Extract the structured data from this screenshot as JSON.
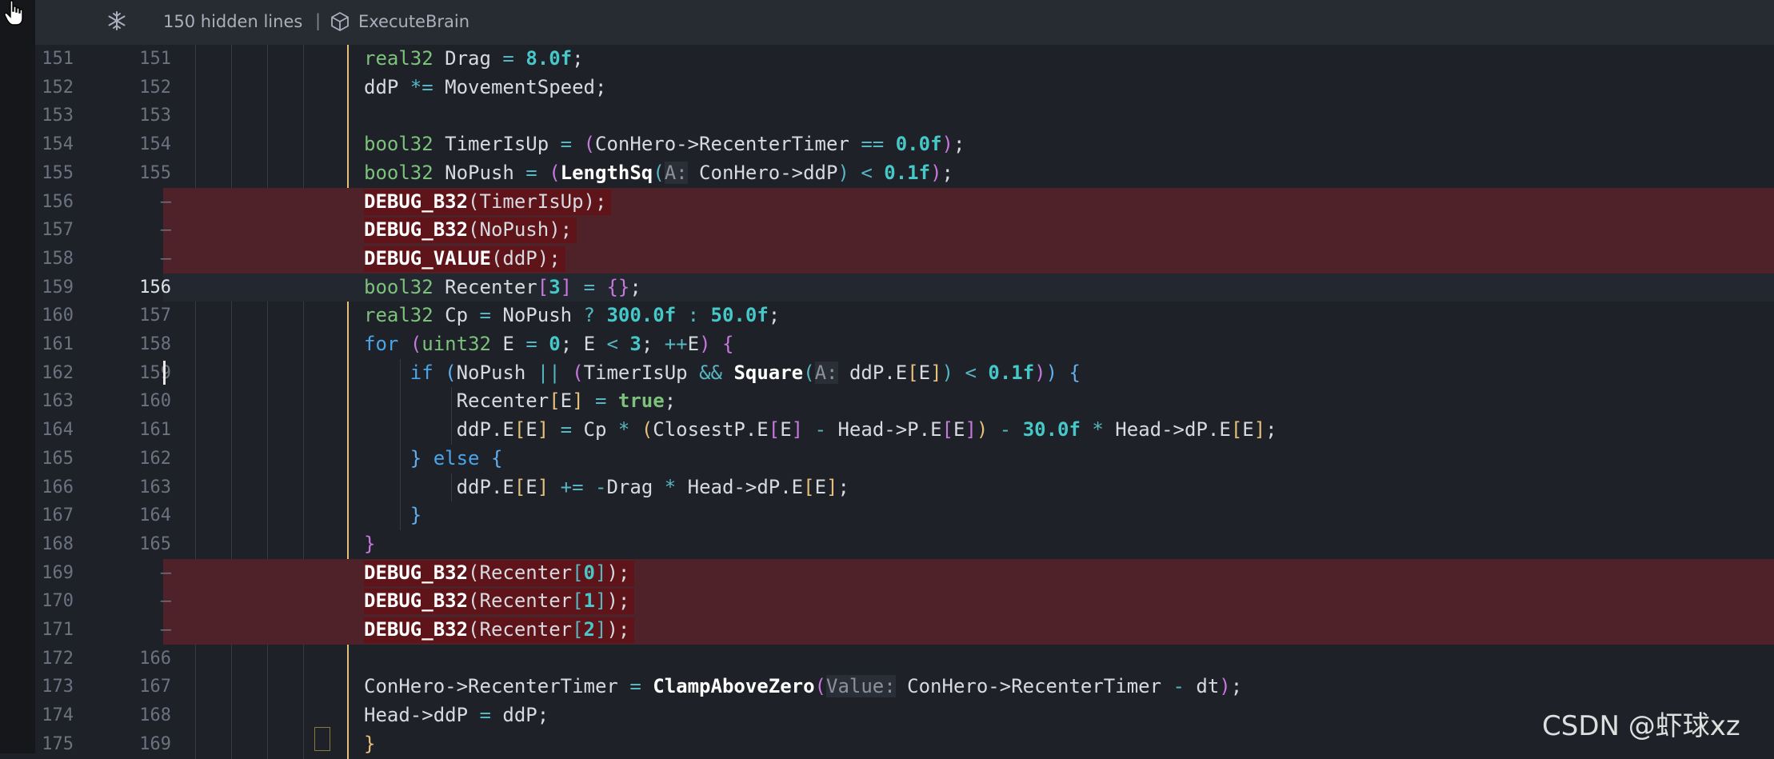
{
  "header": {
    "hidden_lines_label": "150 hidden lines",
    "separator": "|",
    "symbol_name": "ExecuteBrain",
    "fold_icon": "snowflake-fold-icon",
    "symbol_icon": "cube-icon"
  },
  "lines": [
    {
      "old": "151",
      "new": "151",
      "kind": "normal"
    },
    {
      "old": "152",
      "new": "152",
      "kind": "normal"
    },
    {
      "old": "153",
      "new": "153",
      "kind": "normal"
    },
    {
      "old": "154",
      "new": "154",
      "kind": "normal"
    },
    {
      "old": "155",
      "new": "155",
      "kind": "normal"
    },
    {
      "old": "156",
      "new": "—",
      "kind": "deleted"
    },
    {
      "old": "157",
      "new": "—",
      "kind": "deleted"
    },
    {
      "old": "158",
      "new": "—",
      "kind": "deleted"
    },
    {
      "old": "159",
      "new": "156",
      "kind": "current"
    },
    {
      "old": "160",
      "new": "157",
      "kind": "normal"
    },
    {
      "old": "161",
      "new": "158",
      "kind": "normal"
    },
    {
      "old": "162",
      "new": "159",
      "kind": "normal"
    },
    {
      "old": "163",
      "new": "160",
      "kind": "normal"
    },
    {
      "old": "164",
      "new": "161",
      "kind": "normal"
    },
    {
      "old": "165",
      "new": "162",
      "kind": "normal"
    },
    {
      "old": "166",
      "new": "163",
      "kind": "normal"
    },
    {
      "old": "167",
      "new": "164",
      "kind": "normal"
    },
    {
      "old": "168",
      "new": "165",
      "kind": "normal"
    },
    {
      "old": "169",
      "new": "—",
      "kind": "deleted"
    },
    {
      "old": "170",
      "new": "—",
      "kind": "deleted"
    },
    {
      "old": "171",
      "new": "—",
      "kind": "deleted"
    },
    {
      "old": "172",
      "new": "166",
      "kind": "normal"
    },
    {
      "old": "173",
      "new": "167",
      "kind": "normal"
    },
    {
      "old": "174",
      "new": "168",
      "kind": "normal"
    },
    {
      "old": "175",
      "new": "169",
      "kind": "normal"
    }
  ],
  "code": [
    [
      [
        "real32",
        "type"
      ],
      [
        " Drag ",
        ""
      ],
      [
        "=",
        "op2"
      ],
      [
        " ",
        ""
      ],
      [
        "8.0f",
        "num"
      ],
      [
        ";",
        ""
      ]
    ],
    [
      [
        "ddP ",
        ""
      ],
      [
        "*=",
        "op2"
      ],
      [
        " MovementSpeed;",
        ""
      ]
    ],
    [],
    [
      [
        "bool32",
        "type"
      ],
      [
        " TimerIsUp ",
        ""
      ],
      [
        "=",
        "op2"
      ],
      [
        " ",
        ""
      ],
      [
        "(",
        "p1"
      ],
      [
        "ConHero->RecenterTimer ",
        ""
      ],
      [
        "==",
        "op2"
      ],
      [
        " ",
        ""
      ],
      [
        "0.0f",
        "num"
      ],
      [
        ")",
        "p1"
      ],
      [
        ";",
        ""
      ]
    ],
    [
      [
        "bool32",
        "type"
      ],
      [
        " NoPush ",
        ""
      ],
      [
        "=",
        "op2"
      ],
      [
        " ",
        ""
      ],
      [
        "(",
        "p1"
      ],
      [
        "LengthSq",
        "fn"
      ],
      [
        "(",
        "p2"
      ],
      [
        "A:",
        "hint"
      ],
      [
        " ConHero->ddP",
        ""
      ],
      [
        ")",
        "p2"
      ],
      [
        " ",
        ""
      ],
      [
        "<",
        "op2"
      ],
      [
        " ",
        ""
      ],
      [
        "0.1f",
        "num"
      ],
      [
        ")",
        "p1"
      ],
      [
        ";",
        ""
      ]
    ],
    [
      [
        "DEBUG_B32",
        "macro"
      ],
      [
        "(TimerIsUp);",
        ""
      ]
    ],
    [
      [
        "DEBUG_B32",
        "macro"
      ],
      [
        "(NoPush);",
        ""
      ]
    ],
    [
      [
        "DEBUG_VALUE",
        "macro"
      ],
      [
        "(ddP);",
        ""
      ]
    ],
    [
      [
        "bool32",
        "type"
      ],
      [
        " Recenter",
        ""
      ],
      [
        "[",
        "p1"
      ],
      [
        "3",
        "num"
      ],
      [
        "]",
        "p1"
      ],
      [
        " ",
        ""
      ],
      [
        "=",
        "op2"
      ],
      [
        " ",
        ""
      ],
      [
        "{}",
        "p1"
      ],
      [
        ";",
        ""
      ]
    ],
    [
      [
        "real32",
        "type"
      ],
      [
        " Cp ",
        ""
      ],
      [
        "=",
        "op2"
      ],
      [
        " NoPush ",
        ""
      ],
      [
        "?",
        "op2"
      ],
      [
        " ",
        ""
      ],
      [
        "300.0f",
        "num"
      ],
      [
        " ",
        ""
      ],
      [
        ":",
        "op2"
      ],
      [
        " ",
        ""
      ],
      [
        "50.0f",
        "num"
      ],
      [
        ";",
        ""
      ]
    ],
    [
      [
        "for",
        "kw"
      ],
      [
        " ",
        ""
      ],
      [
        "(",
        "p1"
      ],
      [
        "uint32",
        "type"
      ],
      [
        " E ",
        ""
      ],
      [
        "=",
        "op2"
      ],
      [
        " ",
        ""
      ],
      [
        "0",
        "num"
      ],
      [
        "; E ",
        ""
      ],
      [
        "<",
        "op2"
      ],
      [
        " ",
        ""
      ],
      [
        "3",
        "num"
      ],
      [
        "; ",
        ""
      ],
      [
        "++",
        "op2"
      ],
      [
        "E",
        ""
      ],
      [
        ")",
        "p1"
      ],
      [
        " ",
        ""
      ],
      [
        "{",
        "p1"
      ]
    ],
    [
      [
        "    ",
        ""
      ],
      [
        "if",
        "kw"
      ],
      [
        " ",
        ""
      ],
      [
        "(",
        "p4"
      ],
      [
        "NoPush ",
        ""
      ],
      [
        "||",
        "op2"
      ],
      [
        " ",
        ""
      ],
      [
        "(",
        "p1"
      ],
      [
        "TimerIsUp ",
        ""
      ],
      [
        "&&",
        "op2"
      ],
      [
        " ",
        ""
      ],
      [
        "Square",
        "fn"
      ],
      [
        "(",
        "p2"
      ],
      [
        "A:",
        "hint"
      ],
      [
        " ddP.E",
        ""
      ],
      [
        "[",
        "p3"
      ],
      [
        "E",
        ""
      ],
      [
        "]",
        "p3"
      ],
      [
        ")",
        "p2"
      ],
      [
        " ",
        ""
      ],
      [
        "<",
        "op2"
      ],
      [
        " ",
        ""
      ],
      [
        "0.1f",
        "num"
      ],
      [
        ")",
        "p1"
      ],
      [
        ")",
        "p4"
      ],
      [
        " ",
        ""
      ],
      [
        "{",
        "p4"
      ]
    ],
    [
      [
        "        Recenter",
        ""
      ],
      [
        "[",
        "p3"
      ],
      [
        "E",
        ""
      ],
      [
        "]",
        "p3"
      ],
      [
        " ",
        ""
      ],
      [
        "=",
        "op2"
      ],
      [
        " ",
        ""
      ],
      [
        "true",
        "bool"
      ],
      [
        ";",
        ""
      ]
    ],
    [
      [
        "        ddP.E",
        ""
      ],
      [
        "[",
        "p3"
      ],
      [
        "E",
        ""
      ],
      [
        "]",
        "p3"
      ],
      [
        " ",
        ""
      ],
      [
        "=",
        "op2"
      ],
      [
        " Cp ",
        ""
      ],
      [
        "*",
        "op2"
      ],
      [
        " ",
        ""
      ],
      [
        "(",
        "p3"
      ],
      [
        "ClosestP.E",
        ""
      ],
      [
        "[",
        "p1"
      ],
      [
        "E",
        ""
      ],
      [
        "]",
        "p1"
      ],
      [
        " ",
        ""
      ],
      [
        "-",
        "op2"
      ],
      [
        " Head->P.E",
        ""
      ],
      [
        "[",
        "p1"
      ],
      [
        "E",
        ""
      ],
      [
        "]",
        "p1"
      ],
      [
        ")",
        "p3"
      ],
      [
        " ",
        ""
      ],
      [
        "-",
        "op2"
      ],
      [
        " ",
        ""
      ],
      [
        "30.0f",
        "num"
      ],
      [
        " ",
        ""
      ],
      [
        "*",
        "op2"
      ],
      [
        " Head->dP.E",
        ""
      ],
      [
        "[",
        "p3"
      ],
      [
        "E",
        ""
      ],
      [
        "]",
        "p3"
      ],
      [
        ";",
        ""
      ]
    ],
    [
      [
        "    ",
        ""
      ],
      [
        "}",
        "p4"
      ],
      [
        " ",
        ""
      ],
      [
        "else",
        "kw"
      ],
      [
        " ",
        ""
      ],
      [
        "{",
        "p4"
      ]
    ],
    [
      [
        "        ddP.E",
        ""
      ],
      [
        "[",
        "p3"
      ],
      [
        "E",
        ""
      ],
      [
        "]",
        "p3"
      ],
      [
        " ",
        ""
      ],
      [
        "+=",
        "op2"
      ],
      [
        " ",
        ""
      ],
      [
        "-",
        "op2"
      ],
      [
        "Drag ",
        ""
      ],
      [
        "*",
        "op2"
      ],
      [
        " Head->dP.E",
        ""
      ],
      [
        "[",
        "p3"
      ],
      [
        "E",
        ""
      ],
      [
        "]",
        "p3"
      ],
      [
        ";",
        ""
      ]
    ],
    [
      [
        "    ",
        ""
      ],
      [
        "}",
        "p4"
      ]
    ],
    [
      [
        "}",
        "p1"
      ]
    ],
    [
      [
        "DEBUG_B32",
        "macro"
      ],
      [
        "(Recenter",
        ""
      ],
      [
        "[",
        "p2"
      ],
      [
        "0",
        "num"
      ],
      [
        "]",
        "p2"
      ],
      [
        ");",
        ""
      ]
    ],
    [
      [
        "DEBUG_B32",
        "macro"
      ],
      [
        "(Recenter",
        ""
      ],
      [
        "[",
        "p2"
      ],
      [
        "1",
        "num"
      ],
      [
        "]",
        "p2"
      ],
      [
        ");",
        ""
      ]
    ],
    [
      [
        "DEBUG_B32",
        "macro"
      ],
      [
        "(Recenter",
        ""
      ],
      [
        "[",
        "p2"
      ],
      [
        "2",
        "num"
      ],
      [
        "]",
        "p2"
      ],
      [
        ");",
        ""
      ]
    ],
    [],
    [
      [
        "ConHero->RecenterTimer ",
        ""
      ],
      [
        "=",
        "op2"
      ],
      [
        " ",
        ""
      ],
      [
        "ClampAboveZero",
        "fn"
      ],
      [
        "(",
        "p1"
      ],
      [
        "Value:",
        "hint"
      ],
      [
        " ConHero->RecenterTimer ",
        ""
      ],
      [
        "-",
        "op2"
      ],
      [
        " dt",
        ""
      ],
      [
        ")",
        "p1"
      ],
      [
        ";",
        ""
      ]
    ],
    [
      [
        "Head->ddP ",
        ""
      ],
      [
        "=",
        "op2"
      ],
      [
        " ddP;",
        ""
      ]
    ],
    [
      [
        "}",
        "p3"
      ]
    ]
  ],
  "watermark": "CSDN @虾球xz",
  "colors": {
    "background": "#1e2127",
    "deleted_line": "#4f2229",
    "deleted_highlight": "#5e1419",
    "active_guide": "#e5c07b"
  }
}
